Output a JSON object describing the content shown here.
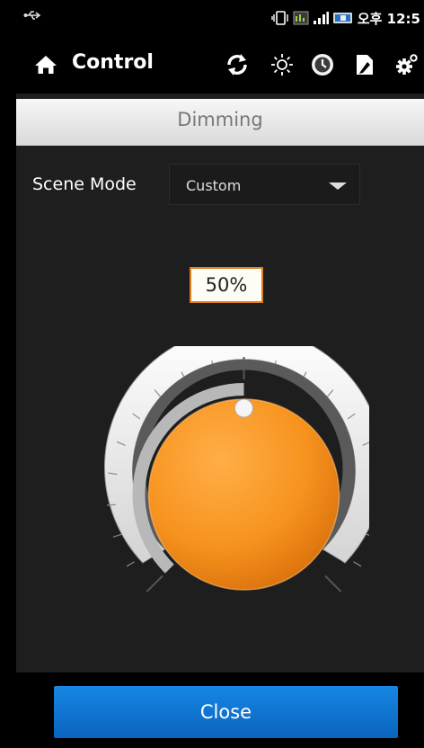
{
  "statusbar": {
    "time": "오후 12:5"
  },
  "actionbar": {
    "title": "Control",
    "icons": [
      "refresh-icon",
      "brightness-icon",
      "clock-icon",
      "document-icon",
      "settings-icon"
    ]
  },
  "header": {
    "title": "Dimming"
  },
  "scene": {
    "label": "Scene Mode",
    "selected": "Custom"
  },
  "dimmer": {
    "level_text": "50%",
    "level": 50
  },
  "footer": {
    "close_label": "Close"
  },
  "colors": {
    "accent": "#f7931e",
    "button": "#0f74d1",
    "background": "#1e1e1e"
  }
}
